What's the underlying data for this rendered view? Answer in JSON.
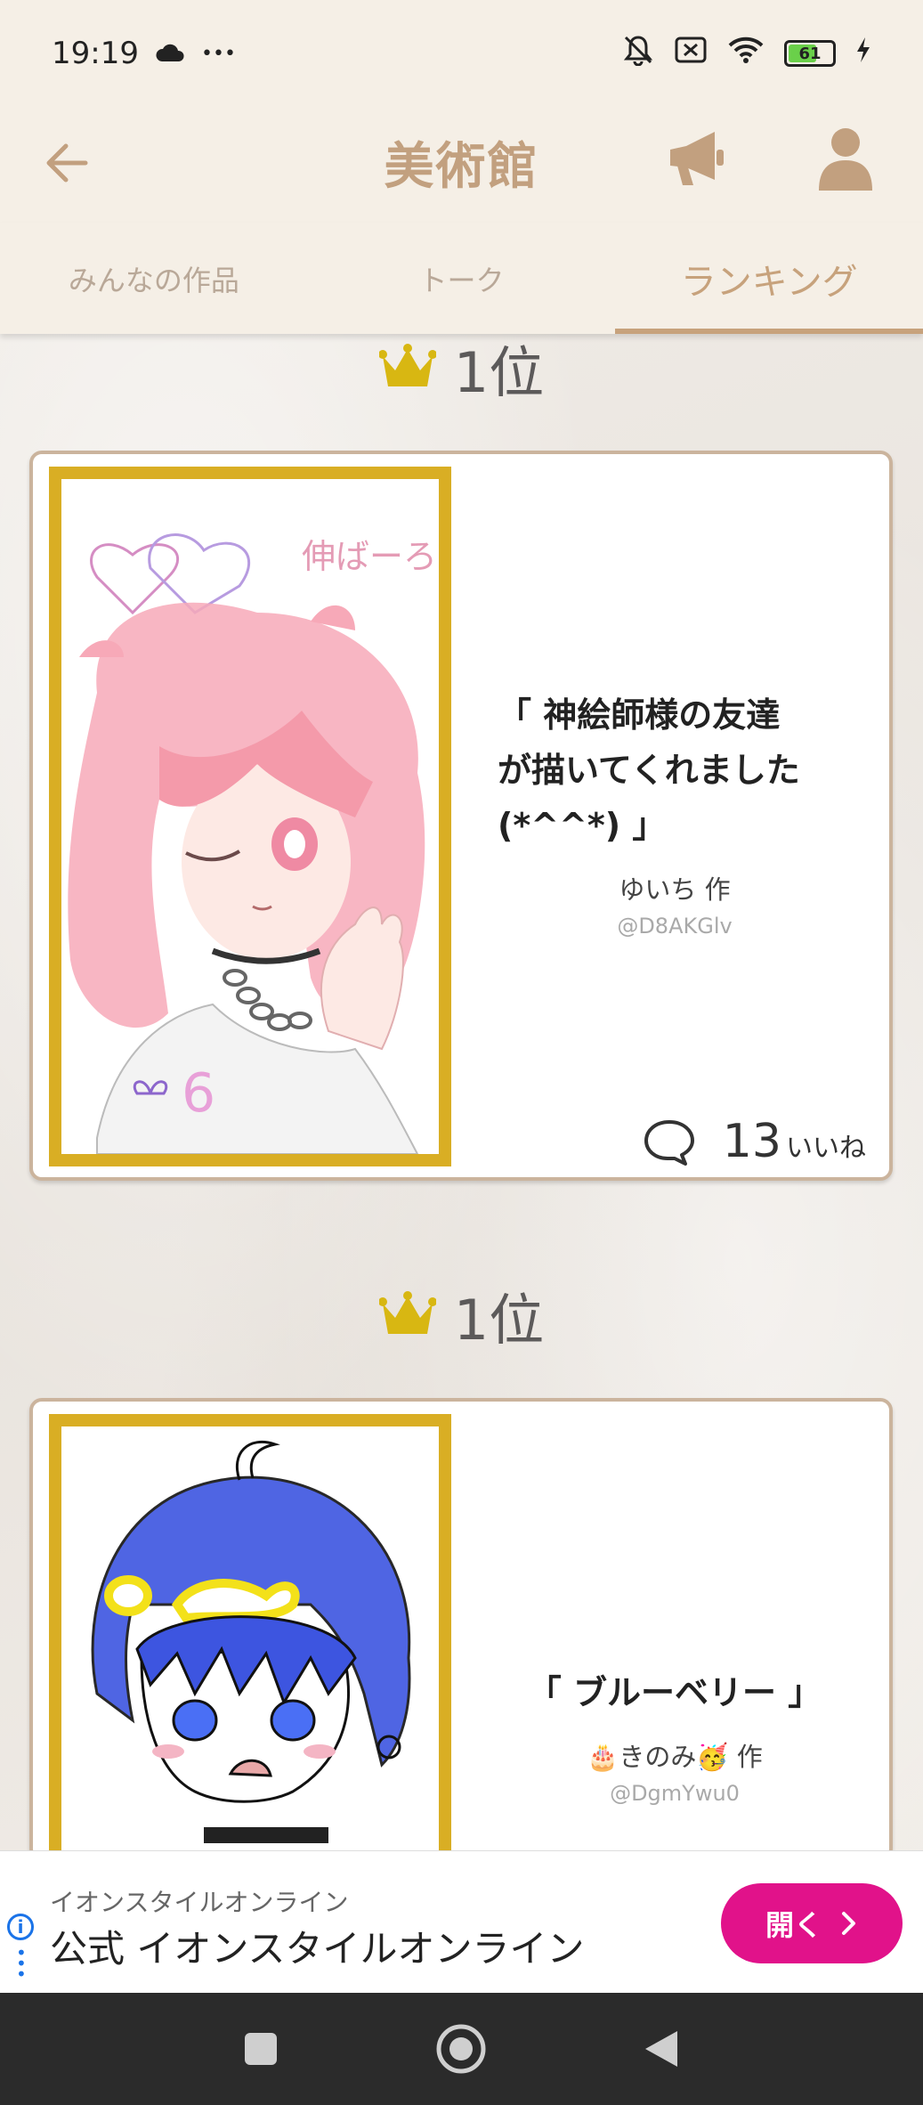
{
  "status_bar": {
    "time": "19:19",
    "more": "•••",
    "battery": "61"
  },
  "header": {
    "title": "美術館"
  },
  "tabs": [
    {
      "label": "みんなの作品",
      "active": false
    },
    {
      "label": "トーク",
      "active": false
    },
    {
      "label": "ランキング",
      "active": true
    }
  ],
  "rankings": [
    {
      "rank": "1位",
      "title": "「 神絵師様の友達が描いてくれました(*^^*) 」",
      "title_lines": [
        "「 神絵師様の友達",
        "が描いてくれました",
        "(*^^*) 」"
      ],
      "author": "ゆいち 作",
      "handle": "@D8AKGlv",
      "likes": "13",
      "likes_unit": "いいね",
      "artwork_text": "伸ばーろ~"
    },
    {
      "rank": "1位",
      "title": "「 ブルーベリー 」",
      "author": "🎂きのみ🥳 作",
      "handle": "@DgmYwu0"
    }
  ],
  "ad": {
    "advertiser": "イオンスタイルオンライン",
    "headline": "公式 イオンスタイルオンライン",
    "cta": "開く"
  },
  "colors": {
    "accent": "#c7a27c",
    "frame_gold": "#d9ae24",
    "crown": "#d8b712",
    "ad_button": "#e1128a"
  }
}
